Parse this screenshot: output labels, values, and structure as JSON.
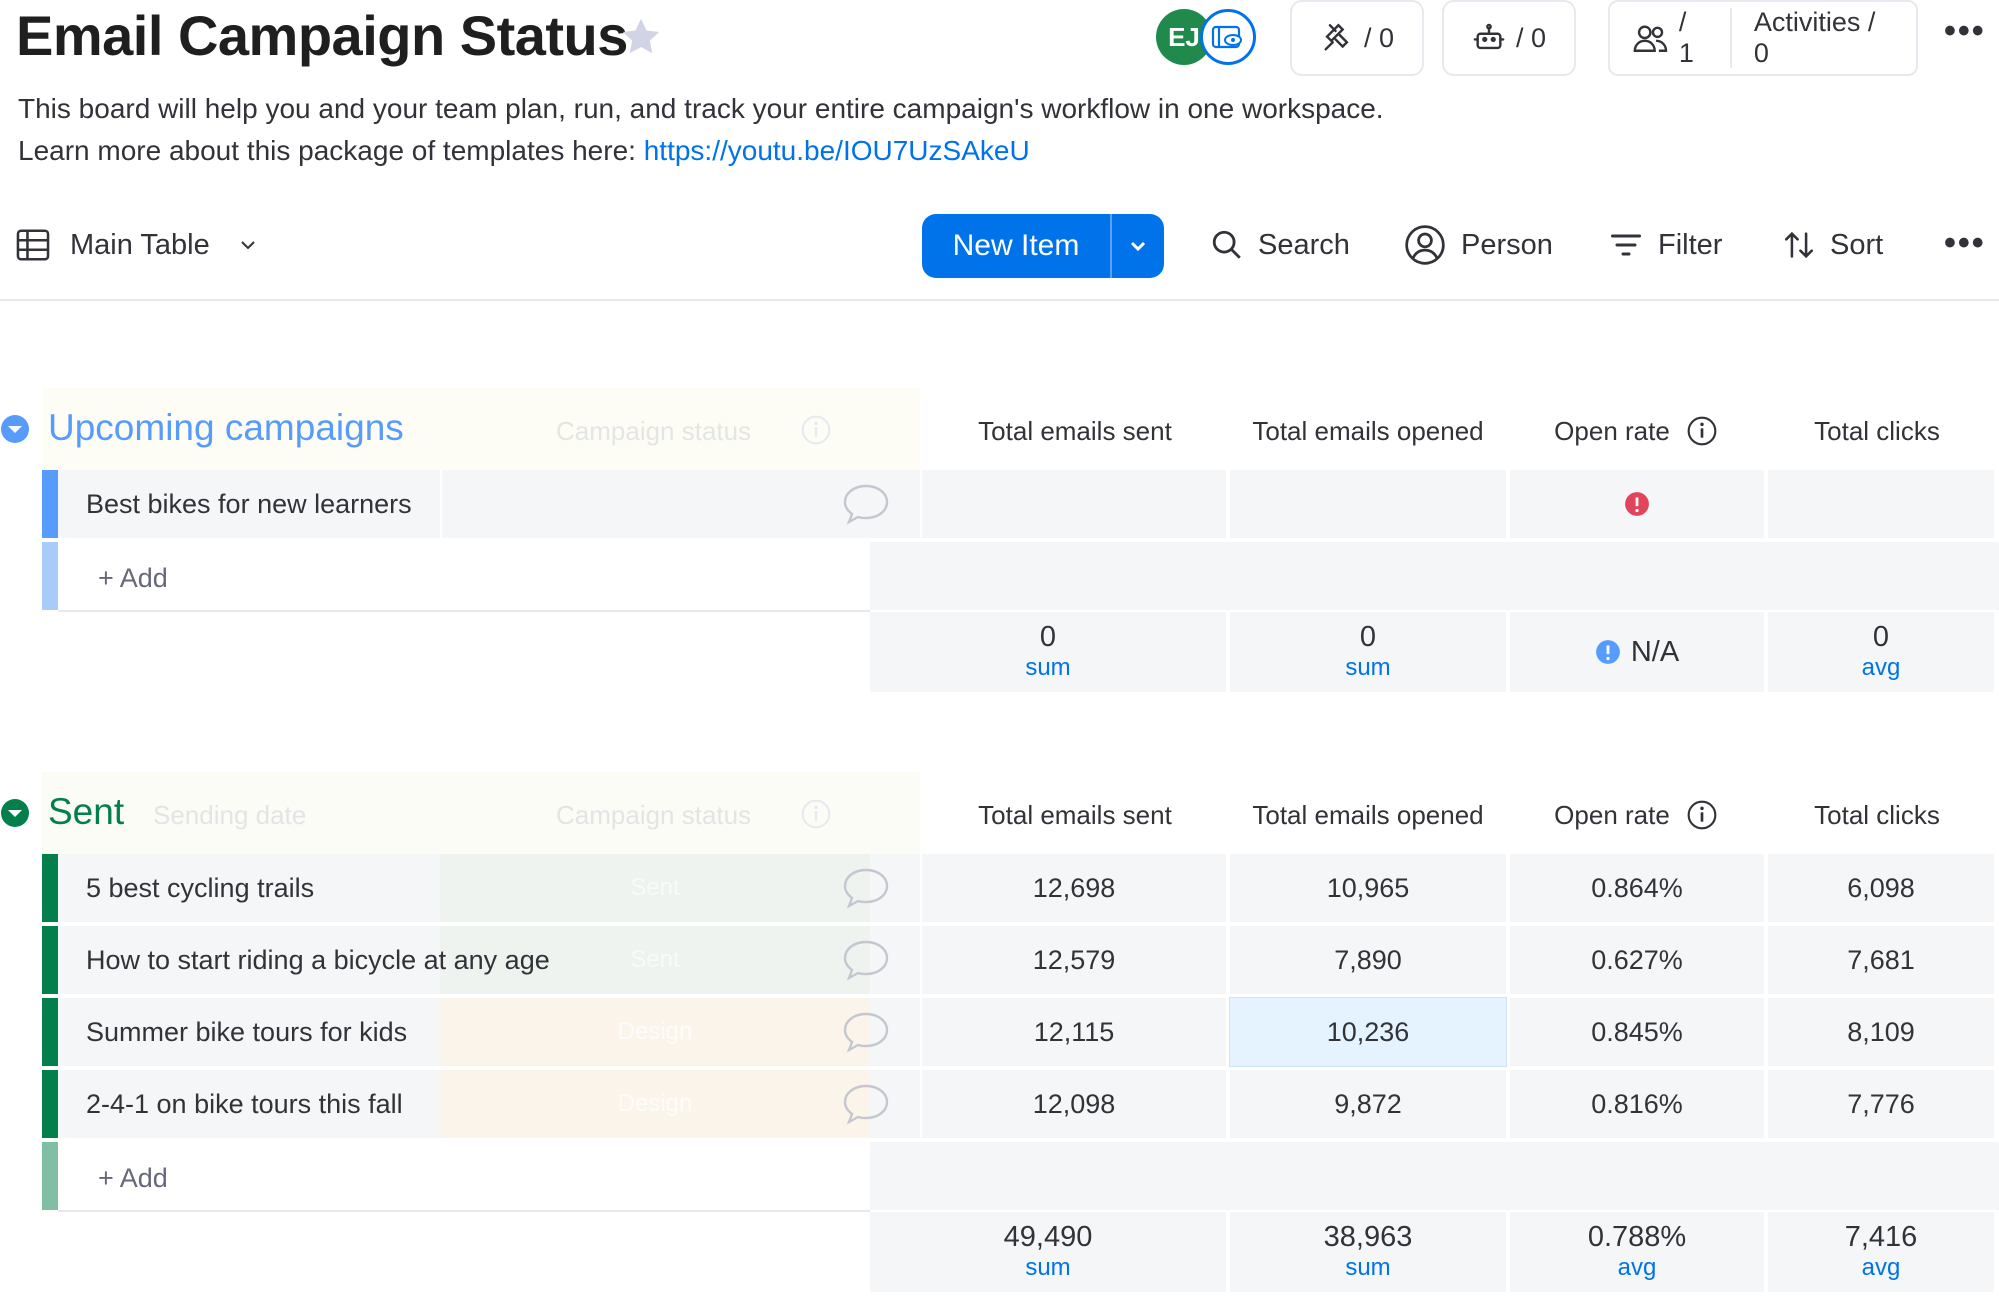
{
  "board": {
    "title": "Email Campaign Status",
    "description_line1": "This board will help you and your team plan, run, and track your entire campaign's workflow in one workspace.",
    "description_line2_prefix": "Learn more about this package of templates here: ",
    "description_link": "https://youtu.be/IOU7UzSAkeU"
  },
  "header": {
    "avatar_initials": "EJ",
    "integrations_count": "/ 0",
    "automations_count": "/ 0",
    "members_count": "/ 1",
    "activities_label": "Activities / 0"
  },
  "toolbar": {
    "view_name": "Main Table",
    "new_item_label": "New Item",
    "search_label": "Search",
    "person_label": "Person",
    "filter_label": "Filter",
    "sort_label": "Sort"
  },
  "columns": {
    "total_sent": "Total emails sent",
    "total_opened": "Total emails opened",
    "open_rate": "Open rate",
    "total_clicks": "Total clicks",
    "campaign_status": "Campaign status",
    "sending_date": "Sending date"
  },
  "colors": {
    "upcoming": "#579bfc",
    "sent": "#037f4c",
    "primary": "#0073ea"
  },
  "groups": {
    "upcoming": {
      "title": "Upcoming campaigns",
      "rows": [
        {
          "name": "Best bikes for new learners"
        }
      ],
      "add_label": "+ Add",
      "summary": {
        "sent_value": "0",
        "sent_label": "sum",
        "opened_value": "0",
        "opened_label": "sum",
        "rate_value": "N/A",
        "clicks_value": "0",
        "clicks_label": "avg"
      }
    },
    "sent": {
      "title": "Sent",
      "rows": [
        {
          "name": "5 best cycling trails",
          "status": "Sent",
          "sent": "12,698",
          "opened": "10,965",
          "rate": "0.864%",
          "clicks": "6,098"
        },
        {
          "name": "How to start riding a bicycle at any age",
          "status": "Sent",
          "sent": "12,579",
          "opened": "7,890",
          "rate": "0.627%",
          "clicks": "7,681"
        },
        {
          "name": "Summer bike tours for kids",
          "status": "Design",
          "sent": "12,115",
          "opened": "10,236",
          "rate": "0.845%",
          "clicks": "8,109"
        },
        {
          "name": "2-4-1 on bike tours this fall",
          "status": "Design",
          "sent": "12,098",
          "opened": "9,872",
          "rate": "0.816%",
          "clicks": "7,776"
        }
      ],
      "add_label": "+ Add",
      "summary": {
        "sent_value": "49,490",
        "sent_label": "sum",
        "opened_value": "38,963",
        "opened_label": "sum",
        "rate_value": "0.788%",
        "rate_label": "avg",
        "clicks_value": "7,416",
        "clicks_label": "avg"
      }
    }
  }
}
